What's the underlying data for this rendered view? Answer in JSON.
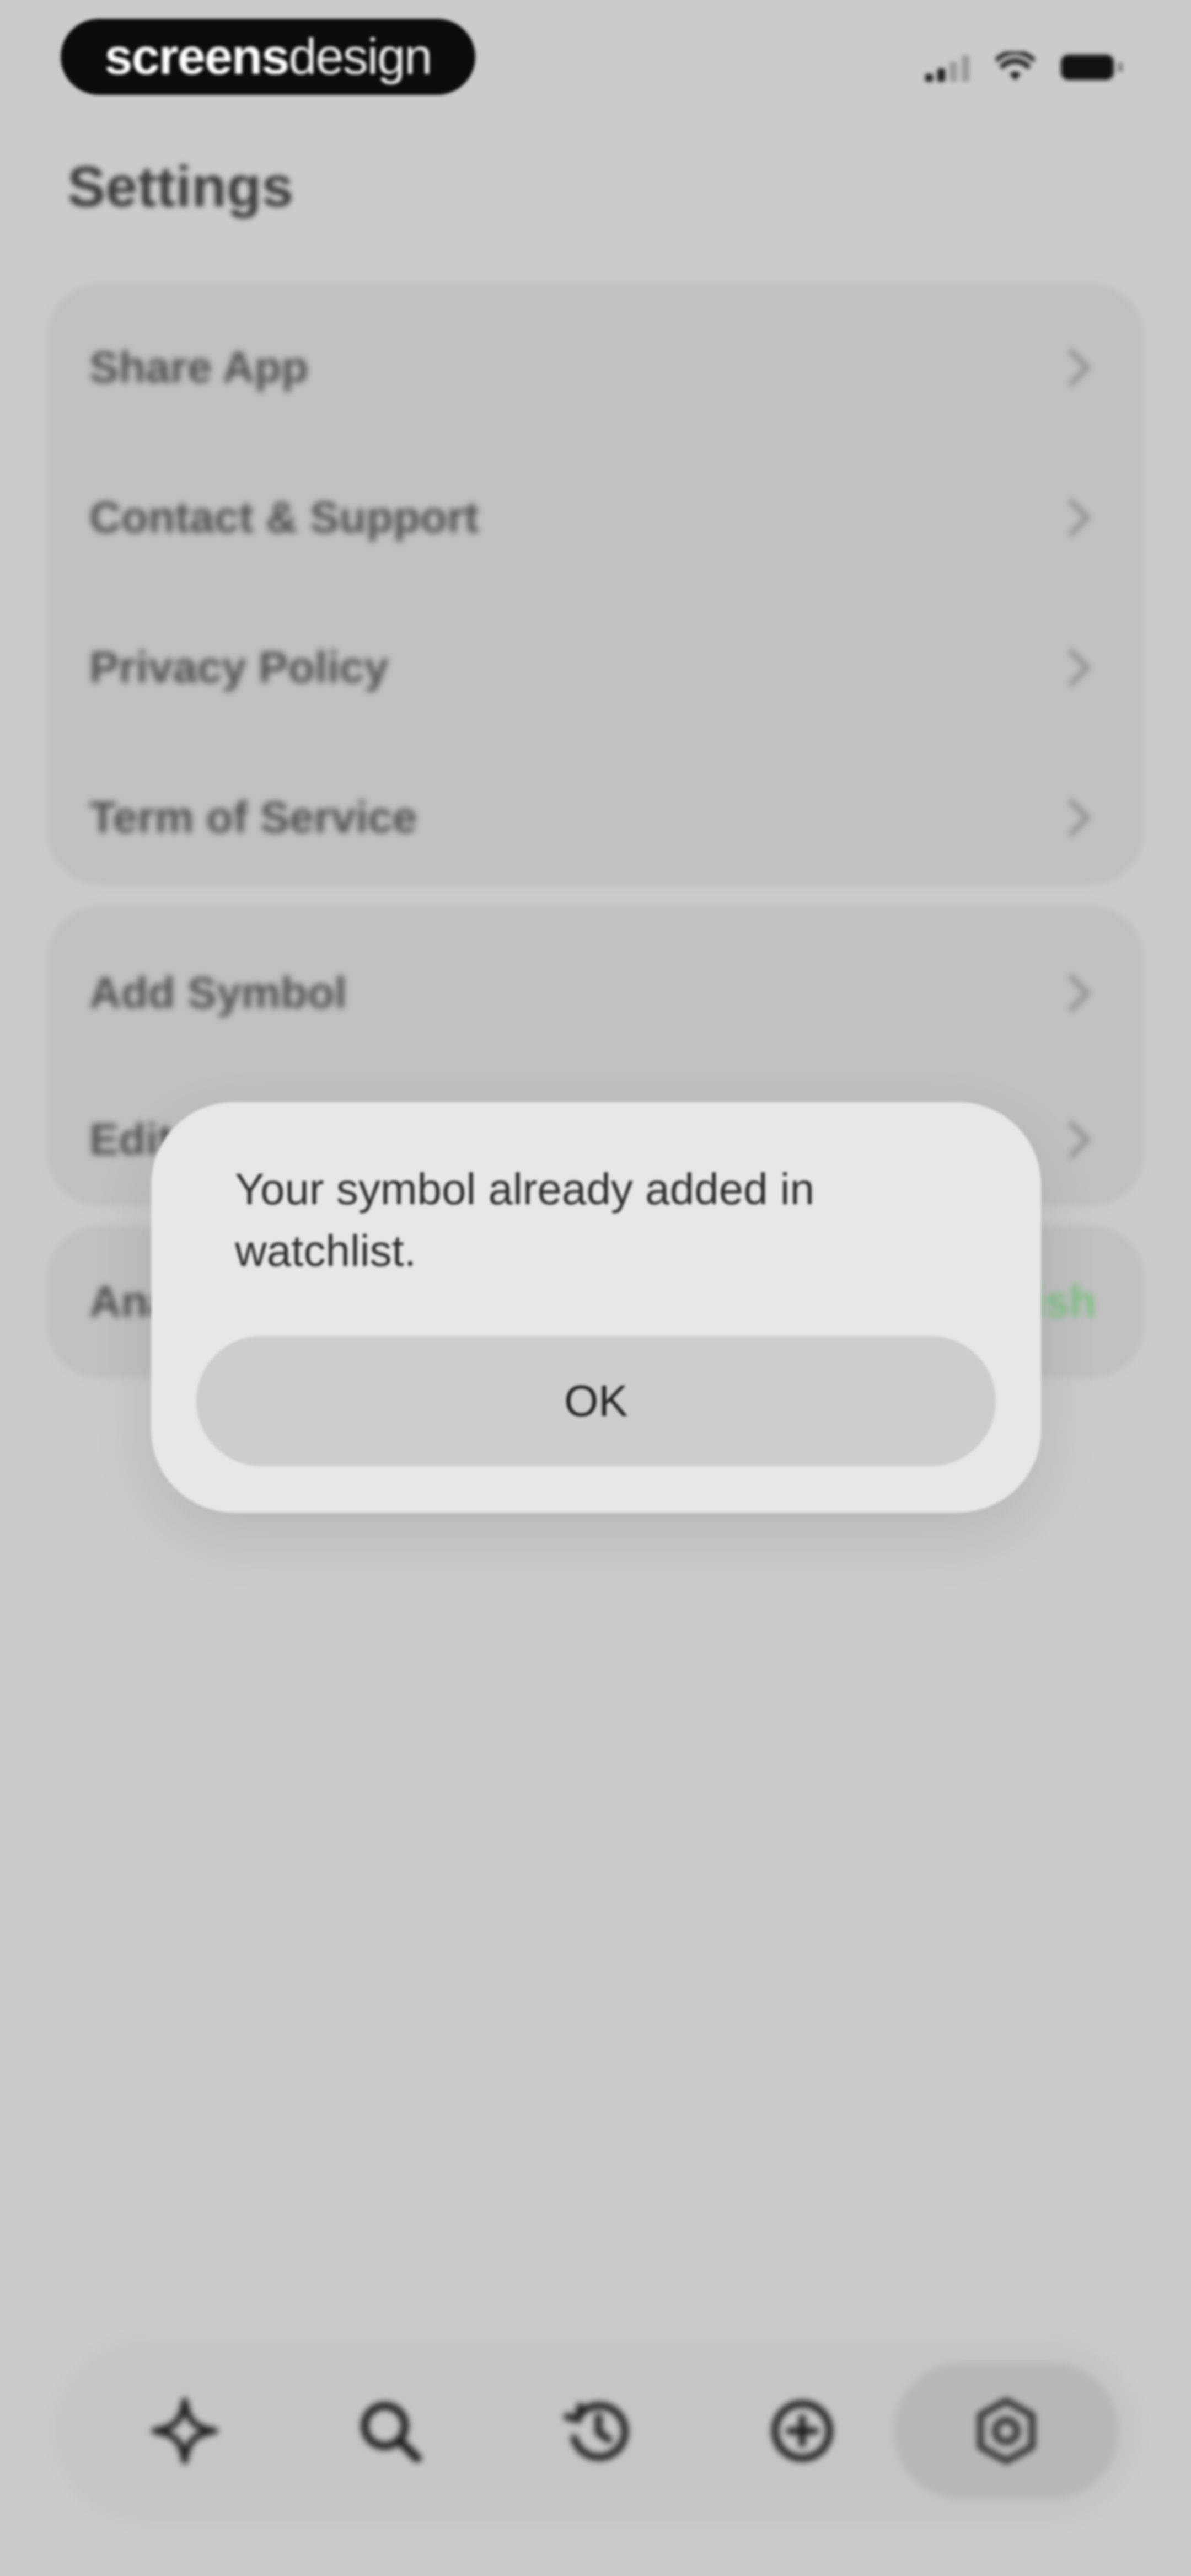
{
  "status_bar": {
    "brand_bold": "screens",
    "brand_light": "design"
  },
  "header": {
    "title": "Settings"
  },
  "groups": [
    {
      "items": [
        {
          "label": "Share App"
        },
        {
          "label": "Contact & Support"
        },
        {
          "label": "Privacy Policy"
        },
        {
          "label": "Term of Service"
        }
      ]
    },
    {
      "items": [
        {
          "label": "Add Symbol"
        },
        {
          "label": "Edit Symbols"
        }
      ]
    },
    {
      "items": [
        {
          "label": "Analysis Language",
          "value": "English"
        }
      ]
    }
  ],
  "alert": {
    "message": "Your symbol already added in watchlist.",
    "ok_label": "OK"
  },
  "tabbar": {
    "tabs": [
      {
        "icon": "sparkle-icon",
        "active": false
      },
      {
        "icon": "search-icon",
        "active": false
      },
      {
        "icon": "history-icon",
        "active": false
      },
      {
        "icon": "add-circle-icon",
        "active": false
      },
      {
        "icon": "settings-gear-icon",
        "active": true
      }
    ]
  },
  "colors": {
    "background": "#cbcbcb",
    "group_bg": "#c0c0c0",
    "alert_bg": "#e7e7e7",
    "accent_green": "#7fbf85"
  }
}
